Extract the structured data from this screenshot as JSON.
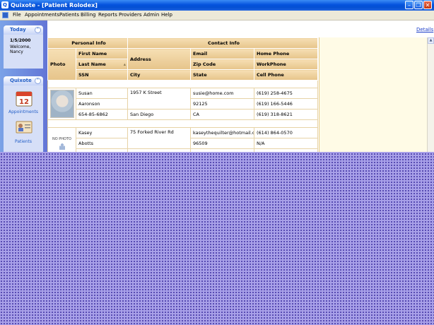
{
  "window": {
    "title": "Quixote - [Patient Rolodex]"
  },
  "menu": [
    "File",
    "Appointments",
    "Patients",
    "Billing",
    "Reports",
    "Providers",
    "Admin",
    "Help"
  ],
  "sidebar": {
    "today": {
      "title": "Today",
      "date": "1/5/2000",
      "welcome": "Welcome, Nancy"
    },
    "nav": {
      "title": "Quixote",
      "items": [
        {
          "label": "Appointments",
          "icon": "calendar-icon",
          "icon_text": "12"
        },
        {
          "label": "Patients",
          "icon": "patient-card-icon"
        }
      ]
    }
  },
  "details_link": "Details",
  "grid": {
    "group_headers": {
      "personal": "Personal Info",
      "contact": "Contact Info"
    },
    "headers": {
      "photo": "Photo",
      "first_name": "First Name",
      "last_name": "Last Name",
      "ssn": "SSN",
      "address": "Address",
      "city": "City",
      "email": "Email",
      "zip": "Zip Code",
      "state": "State",
      "home_phone": "Home Phone",
      "work_phone": "WorkPhone",
      "cell_phone": "Cell Phone"
    },
    "patients": [
      {
        "photo": "photo",
        "first_name": "Susan",
        "last_name": "Aaronson",
        "ssn": "654-85-6862",
        "address": "1957 K Street",
        "city": "San Diego",
        "email": "susie@home.com",
        "zip": "92125",
        "state": "CA",
        "home_phone": "(619) 258-4675",
        "work_phone": "(619) 166-5446",
        "cell_phone": "(619) 318-8621"
      },
      {
        "photo": "NO PHOTO",
        "first_name": "Kasey",
        "last_name": "Abotts",
        "ssn": "",
        "address": "75 Forked River Rd",
        "city": "",
        "email": "kaseythequilter@hotmail.c...",
        "zip": "96509",
        "state": "",
        "home_phone": "(614) 864-0570",
        "work_phone": "N/A",
        "cell_phone": ""
      }
    ]
  },
  "colors": {
    "title_bar": "#0553dd",
    "grid_header": "#e6c48a",
    "sidebar": "#6375d6",
    "backdrop": "#a8a0e8"
  }
}
